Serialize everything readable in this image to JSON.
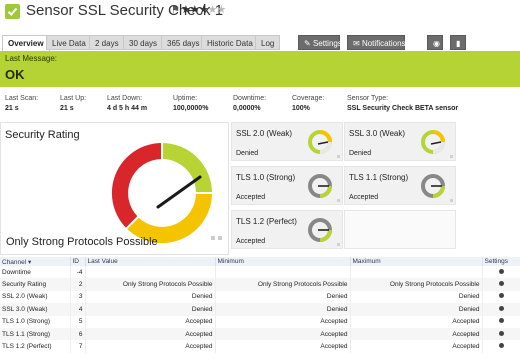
{
  "header": {
    "title": "Sensor SSL Security Check 1",
    "stars_on": 3,
    "stars_total": 5
  },
  "tabs": [
    {
      "label": "Overview"
    },
    {
      "label": "Live Data"
    },
    {
      "label": "2 days"
    },
    {
      "label": "30 days"
    },
    {
      "label": "365 days"
    },
    {
      "label": "Historic Data"
    },
    {
      "label": "Log"
    },
    {
      "label": "Settings"
    },
    {
      "label": "Notifications"
    }
  ],
  "banner": {
    "label": "Last Message:",
    "message": "OK",
    "color": "#b5d334"
  },
  "stats": [
    {
      "key": "Last Scan:",
      "value": "21 s"
    },
    {
      "key": "Last Up:",
      "value": "21 s"
    },
    {
      "key": "Last Down:",
      "value": "4 d 5 h 44 m"
    },
    {
      "key": "Uptime:",
      "value": "100,0000%"
    },
    {
      "key": "Downtime:",
      "value": "0,0000%"
    },
    {
      "key": "Coverage:",
      "value": "100%"
    },
    {
      "key": "Sensor Type:",
      "value": "SSL Security Check BETA sensor"
    }
  ],
  "gauge": {
    "title": "Security Rating",
    "value_text": "Only Strong Protocols Possible",
    "colors": {
      "red": "#d8262b",
      "yellow": "#f5c400",
      "green": "#b7d334"
    }
  },
  "minis": [
    {
      "name": "SSL 2.0 (Weak)",
      "status": "Denied"
    },
    {
      "name": "SSL 3.0 (Weak)",
      "status": "Denied"
    },
    {
      "name": "TLS 1.0 (Strong)",
      "status": "Accepted"
    },
    {
      "name": "TLS 1.1 (Strong)",
      "status": "Accepted"
    },
    {
      "name": "TLS 1.2 (Perfect)",
      "status": "Accepted"
    }
  ],
  "table": {
    "headers": {
      "channel": "Channel",
      "id": "ID",
      "last": "Last Value",
      "min": "Minimum",
      "max": "Maximum",
      "settings": "Settings"
    },
    "rows": [
      {
        "channel": "Downtime",
        "id": "-4",
        "last": "",
        "min": "",
        "max": ""
      },
      {
        "channel": "Security Rating",
        "id": "2",
        "last": "Only Strong Protocols Possible",
        "min": "Only Strong Protocols Possible",
        "max": "Only Strong Protocols Possible"
      },
      {
        "channel": "SSL 2.0 (Weak)",
        "id": "3",
        "last": "Denied",
        "min": "Denied",
        "max": "Denied"
      },
      {
        "channel": "SSL 3.0 (Weak)",
        "id": "4",
        "last": "Denied",
        "min": "Denied",
        "max": "Denied"
      },
      {
        "channel": "TLS 1.0 (Strong)",
        "id": "5",
        "last": "Accepted",
        "min": "Accepted",
        "max": "Accepted"
      },
      {
        "channel": "TLS 1.1 (Strong)",
        "id": "6",
        "last": "Accepted",
        "min": "Accepted",
        "max": "Accepted"
      },
      {
        "channel": "TLS 1.2 (Perfect)",
        "id": "7",
        "last": "Accepted",
        "min": "Accepted",
        "max": "Accepted"
      }
    ]
  }
}
